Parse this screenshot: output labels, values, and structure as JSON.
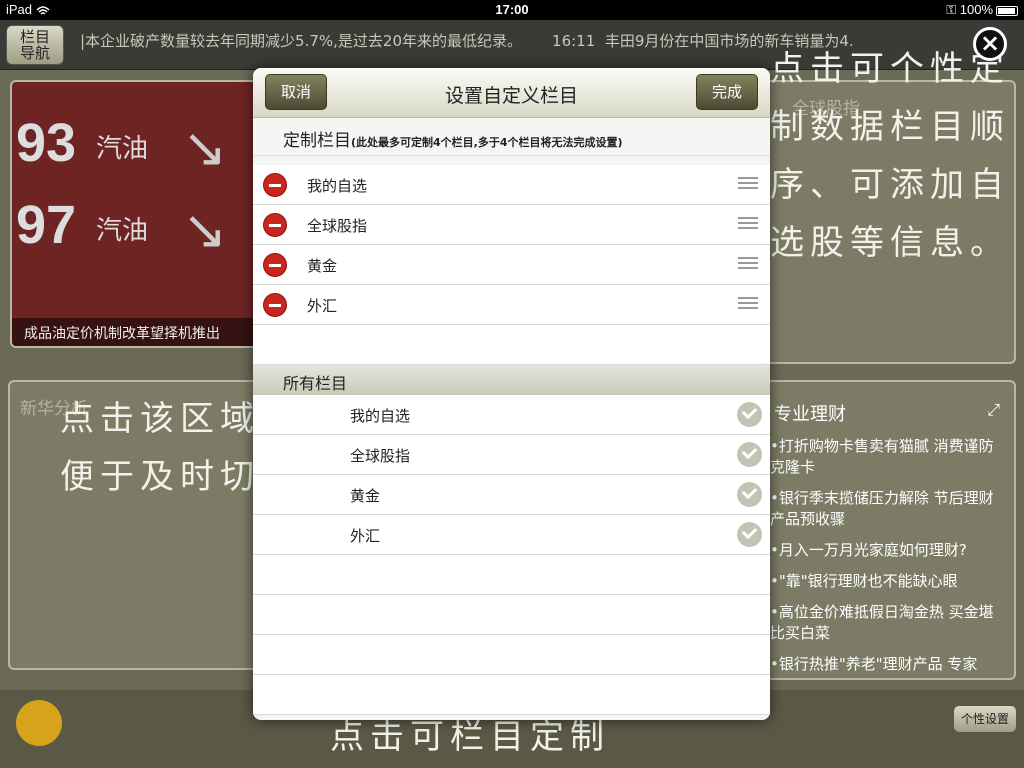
{
  "status_bar": {
    "device": "iPad",
    "time": "17:00",
    "battery": "100%"
  },
  "ticker": {
    "nav_label_line1": "栏目",
    "nav_label_line2": "导航",
    "headline_1": "|本企业破产数量较去年同期减少5.7%,是过去20年来的最低纪录。",
    "headline_2_time": "16:11",
    "headline_2": "丰田9月份在中国市场的新车销量为4."
  },
  "background": {
    "news_caption": "成品油定价机制改革望择机推出",
    "fuel_93_num": "93",
    "fuel_93_label": "汽油",
    "fuel_97_num": "97",
    "fuel_97_label": "汽油",
    "global_panel_title": "全球股指",
    "xinhua_panel_title": "新华分析",
    "finance_panel_title": "专业理财",
    "finance_items": [
      "•打折购物卡售卖有猫腻 消费谨防克隆卡",
      "•银行季末揽储压力解除 节后理财产品预收骤",
      "•月入一万月光家庭如何理财?",
      "•\"靠\"银行理财也不能缺心眼",
      "•高位金价难抵假日淘金热 买金堪比买白菜",
      "•银行热推\"养老\"理财产品 专家"
    ],
    "hint_right": "点击可个性定制数据栏目顺序、可添加自选股等信息。",
    "hint_left": "点击该区域便于及时切",
    "hint_bottom": "点击可栏目定制",
    "personal_btn": "个性设置"
  },
  "modal": {
    "title": "设置自定义栏目",
    "cancel_label": "取消",
    "done_label": "完成",
    "custom_section_title": "定制栏目",
    "custom_section_note": "(此处最多可定制4个栏目,多于4个栏目将无法完成设置)",
    "custom_items": [
      "我的自选",
      "全球股指",
      "黄金",
      "外汇"
    ],
    "all_section_title": "所有栏目",
    "all_items": [
      "我的自选",
      "全球股指",
      "黄金",
      "外汇"
    ]
  },
  "icons": {
    "delete": "minus-circle-icon",
    "reorder": "grip-lines-icon",
    "selected": "checkmark-circle-icon",
    "close": "close-icon"
  },
  "colors": {
    "accent": "#4b4b34",
    "delete_red": "#c8261d",
    "check_gray": "#c4c4b4"
  }
}
